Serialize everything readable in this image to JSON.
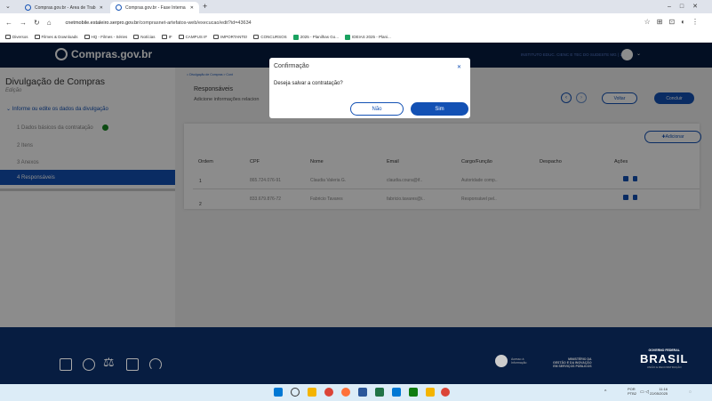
{
  "browser": {
    "tabs": [
      {
        "label": "Compras.gov.br - Área de Trab"
      },
      {
        "label": "Compras.gov.br - Fase Interna"
      }
    ],
    "url_host": "cnetmobile.estaleiro.serpro.gov.br",
    "url_path": "/comprasnet-artefatos-web/execucao/edit?id=43634",
    "bookmarks": [
      "Diversos",
      "Filmes & Downloads",
      "HQ - Filmes - Séries",
      "Notícias",
      "IF",
      "CAMPUS IF",
      "IMPORTANTE!",
      "CONCURSOS",
      "2025 - Planilhas Go...",
      "IDEIAS 2025 - Plani..."
    ]
  },
  "header": {
    "logo": "Compras.gov.br",
    "user": "INSTITUTO EDUC. CIENC E TEC DO SUDESTE MG | 158125"
  },
  "sidebar": {
    "title": "Divulgação de Compras",
    "subtitle": "Edição",
    "section": "Informe ou edite os dados da divulgação",
    "items": [
      {
        "label": "1  Dados básicos da contratação"
      },
      {
        "label": "2  Itens"
      },
      {
        "label": "3  Anexos"
      },
      {
        "label": "4  Responsáveis"
      }
    ]
  },
  "main": {
    "breadcrumb": "Divulgação de Compras  >  Cont",
    "section_title": "Responsáveis",
    "section_desc": "Adicione informações relacion",
    "back_label": "Voltar",
    "finish_label": "Concluir",
    "add_label": "Adicionar",
    "columns": [
      "Ordem",
      "CPF",
      "Nome",
      "Email",
      "Cargo/Função",
      "Despacho",
      "Ações"
    ],
    "rows": [
      {
        "ordem": "1",
        "cpf": "865.724.076-91",
        "nome": "Claudia Valeria G.",
        "email": "claudia.coura@if..",
        "cargo": "Autoridade comp..",
        "despacho": ""
      },
      {
        "ordem": "2",
        "cpf": "833.679.876-72",
        "nome": "Fabricio Tavares",
        "email": "fabricio.tavares@i..",
        "cargo": "Responsável pel..",
        "despacho": ""
      }
    ]
  },
  "modal": {
    "title": "Confirmação",
    "message": "Deseja salvar a contratação?",
    "no_label": "Não",
    "yes_label": "Sim"
  },
  "footer": {
    "acesso": [
      "Acesso à",
      "Informação"
    ],
    "ministerio": [
      "MINISTÉRIO DA",
      "GESTÃO E DA INOVAÇÃO",
      "EM SERVIÇOS PÚBLICOS"
    ],
    "gov_top": "GOVERNO FEDERAL",
    "gov_name": "BRASIL",
    "gov_bottom": "UNIÃO E RECONSTRUÇÃO"
  },
  "taskbar": {
    "lang1": "POR",
    "lang2": "PTB2",
    "time": "11:16",
    "date": "22/05/2025"
  },
  "colors": {
    "primary": "#1351b4",
    "header": "#071d41",
    "success": "#168821"
  }
}
